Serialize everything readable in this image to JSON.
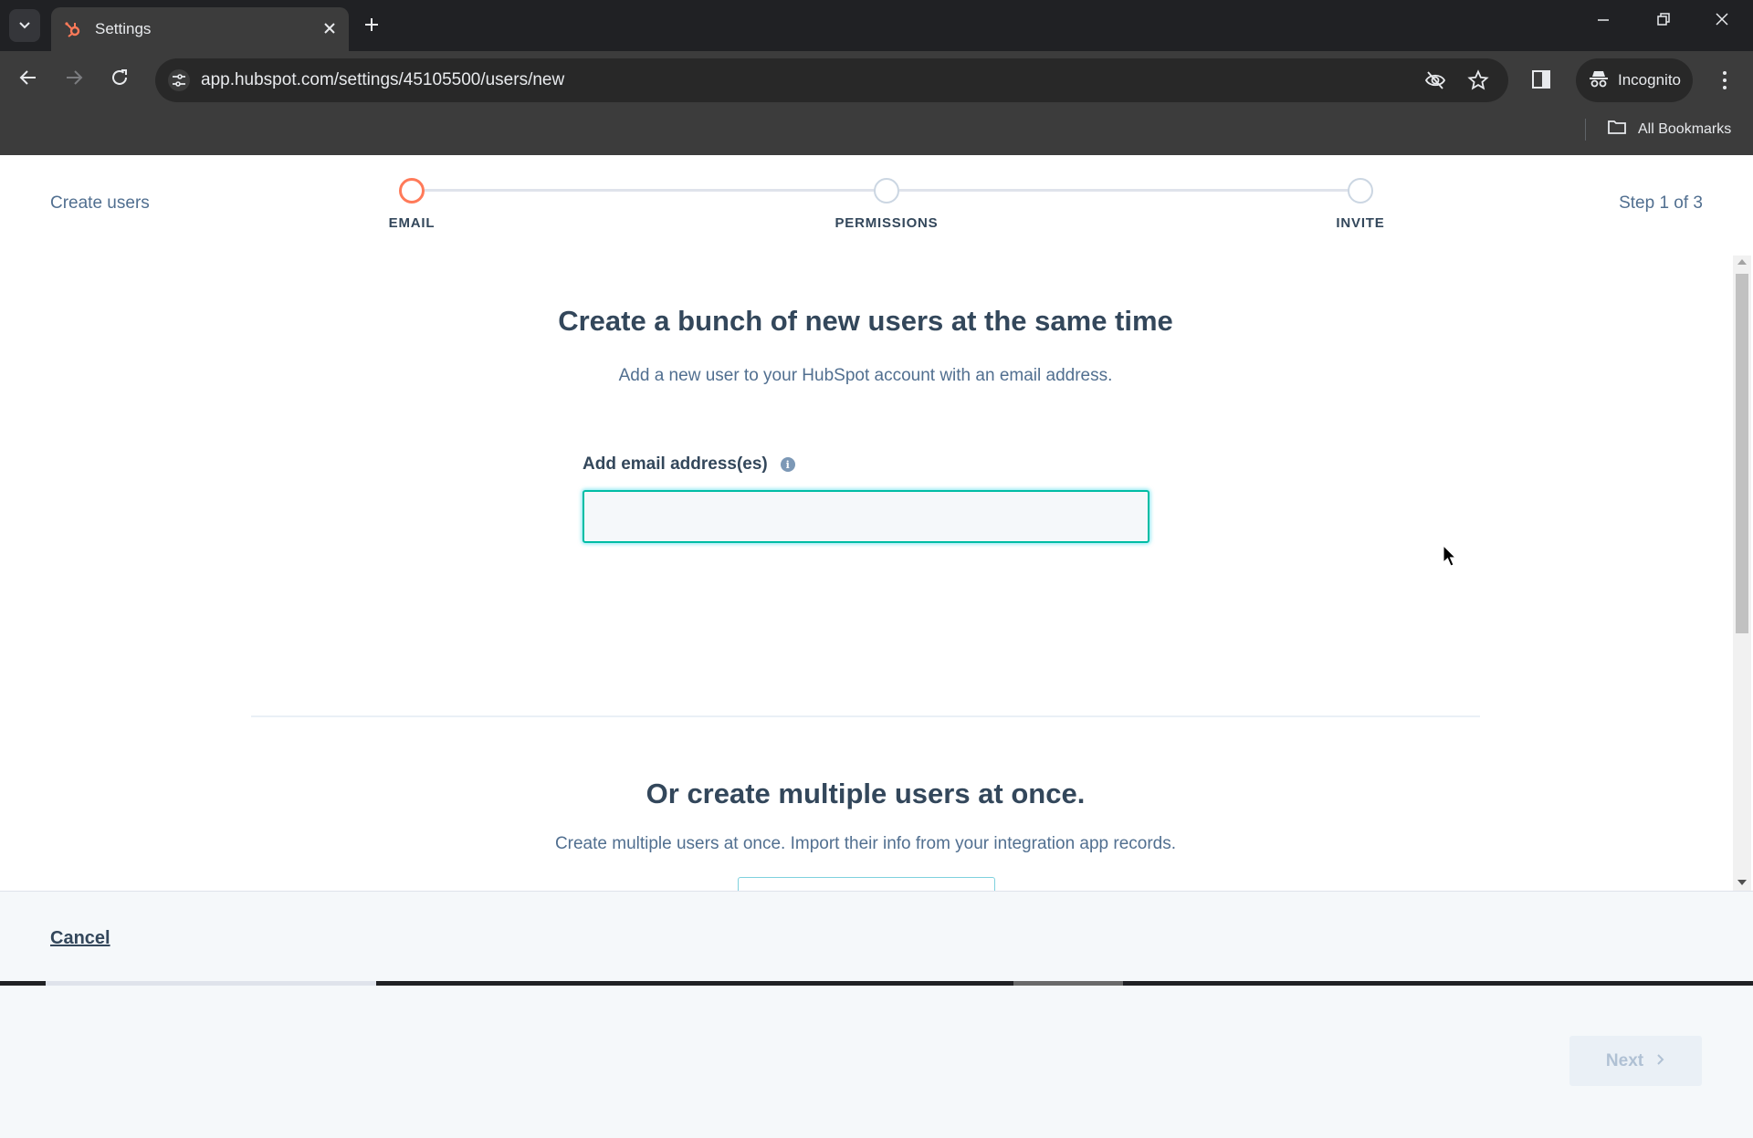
{
  "browser": {
    "tab_title": "Settings",
    "url": "app.hubspot.com/settings/45105500/users/new",
    "incognito_label": "Incognito",
    "bookmarks_label": "All Bookmarks",
    "icons": {
      "tab_search": "chevron-down-icon",
      "favicon": "hubspot-sprocket-icon",
      "close_tab": "close-icon",
      "new_tab": "plus-icon",
      "back": "arrow-left-icon",
      "forward": "arrow-right-icon",
      "reload": "reload-icon",
      "site_info": "tune-icon",
      "tracking_protection": "eye-off-icon",
      "bookmark": "star-icon",
      "side_panel": "side-panel-icon",
      "incognito": "incognito-icon",
      "menu": "kebab-menu-icon",
      "folder": "folder-icon"
    }
  },
  "header": {
    "title": "Create users",
    "step_count": "Step 1 of 3",
    "steps": [
      {
        "label": "EMAIL",
        "active": true
      },
      {
        "label": "PERMISSIONS",
        "active": false
      },
      {
        "label": "INVITE",
        "active": false
      }
    ]
  },
  "main": {
    "heading": "Create a bunch of new users at the same time",
    "subtitle": "Add a new user to your HubSpot account with an email address.",
    "email_field": {
      "label": "Add email address(es)",
      "value": "",
      "placeholder": ""
    },
    "import_section": {
      "heading": "Or create multiple users at once.",
      "subtitle": "Create multiple users at once. Import their info from your integration app records."
    }
  },
  "footer": {
    "cancel_label": "Cancel",
    "next_label": "Next"
  },
  "colors": {
    "accent_orange": "#ff7a59",
    "focus_teal": "#00bda5",
    "text_primary": "#33475b",
    "text_secondary": "#516f90",
    "disabled_text": "#b0c1d4"
  }
}
